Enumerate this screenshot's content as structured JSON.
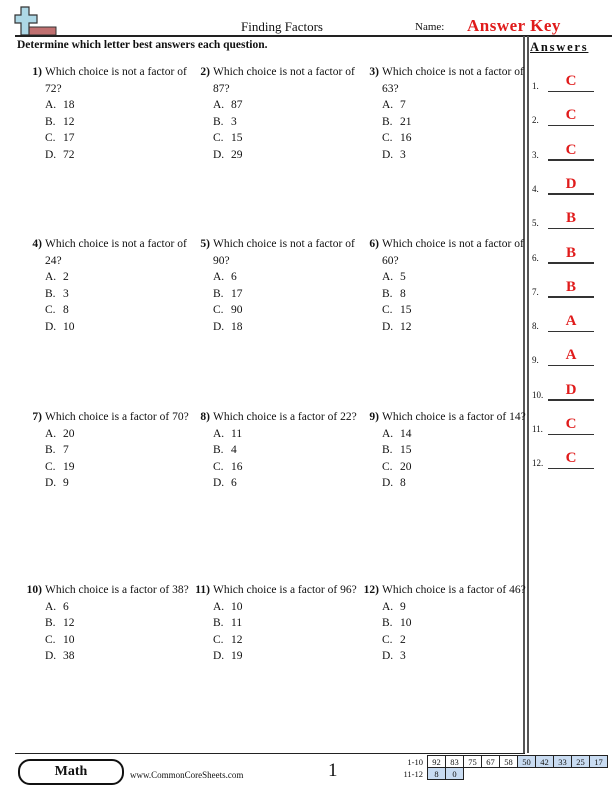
{
  "header": {
    "title": "Finding Factors",
    "name_label": "Name:",
    "name_value": "Answer Key",
    "instructions": "Determine which letter best answers each question."
  },
  "colors": {
    "answer_red": "#e01b1b",
    "logo_blue": "#add8e6",
    "logo_red": "#c07070",
    "score_highlight": "#c9dcf2"
  },
  "answers": {
    "heading": "Answers",
    "items": [
      {
        "num": "1.",
        "value": "C"
      },
      {
        "num": "2.",
        "value": "C"
      },
      {
        "num": "3.",
        "value": "C"
      },
      {
        "num": "4.",
        "value": "D"
      },
      {
        "num": "5.",
        "value": "B"
      },
      {
        "num": "6.",
        "value": "B"
      },
      {
        "num": "7.",
        "value": "B"
      },
      {
        "num": "8.",
        "value": "A"
      },
      {
        "num": "9.",
        "value": "A"
      },
      {
        "num": "10.",
        "value": "D"
      },
      {
        "num": "11.",
        "value": "C"
      },
      {
        "num": "12.",
        "value": "C"
      }
    ]
  },
  "questions": [
    {
      "num": "1)",
      "stem": "Which choice is not a factor of 72?",
      "choices": [
        {
          "letter": "A.",
          "text": "18"
        },
        {
          "letter": "B.",
          "text": "12"
        },
        {
          "letter": "C.",
          "text": "17"
        },
        {
          "letter": "D.",
          "text": "72"
        }
      ]
    },
    {
      "num": "2)",
      "stem": "Which choice is not a factor of 87?",
      "choices": [
        {
          "letter": "A.",
          "text": "87"
        },
        {
          "letter": "B.",
          "text": "3"
        },
        {
          "letter": "C.",
          "text": "15"
        },
        {
          "letter": "D.",
          "text": "29"
        }
      ]
    },
    {
      "num": "3)",
      "stem": "Which choice is not a factor of 63?",
      "choices": [
        {
          "letter": "A.",
          "text": "7"
        },
        {
          "letter": "B.",
          "text": "21"
        },
        {
          "letter": "C.",
          "text": "16"
        },
        {
          "letter": "D.",
          "text": "3"
        }
      ]
    },
    {
      "num": "4)",
      "stem": "Which choice is not a factor of 24?",
      "choices": [
        {
          "letter": "A.",
          "text": "2"
        },
        {
          "letter": "B.",
          "text": "3"
        },
        {
          "letter": "C.",
          "text": "8"
        },
        {
          "letter": "D.",
          "text": "10"
        }
      ]
    },
    {
      "num": "5)",
      "stem": "Which choice is not a factor of 90?",
      "choices": [
        {
          "letter": "A.",
          "text": "6"
        },
        {
          "letter": "B.",
          "text": "17"
        },
        {
          "letter": "C.",
          "text": "90"
        },
        {
          "letter": "D.",
          "text": "18"
        }
      ]
    },
    {
      "num": "6)",
      "stem": "Which choice is not a factor of 60?",
      "choices": [
        {
          "letter": "A.",
          "text": "5"
        },
        {
          "letter": "B.",
          "text": "8"
        },
        {
          "letter": "C.",
          "text": "15"
        },
        {
          "letter": "D.",
          "text": "12"
        }
      ]
    },
    {
      "num": "7)",
      "stem": "Which choice is a factor of 70?",
      "choices": [
        {
          "letter": "A.",
          "text": "20"
        },
        {
          "letter": "B.",
          "text": "7"
        },
        {
          "letter": "C.",
          "text": "19"
        },
        {
          "letter": "D.",
          "text": "9"
        }
      ]
    },
    {
      "num": "8)",
      "stem": "Which choice is a factor of 22?",
      "choices": [
        {
          "letter": "A.",
          "text": "11"
        },
        {
          "letter": "B.",
          "text": "4"
        },
        {
          "letter": "C.",
          "text": "16"
        },
        {
          "letter": "D.",
          "text": "6"
        }
      ]
    },
    {
      "num": "9)",
      "stem": "Which choice is a factor of 14?",
      "choices": [
        {
          "letter": "A.",
          "text": "14"
        },
        {
          "letter": "B.",
          "text": "15"
        },
        {
          "letter": "C.",
          "text": "20"
        },
        {
          "letter": "D.",
          "text": "8"
        }
      ]
    },
    {
      "num": "10)",
      "stem": "Which choice is a factor of 38?",
      "choices": [
        {
          "letter": "A.",
          "text": "6"
        },
        {
          "letter": "B.",
          "text": "12"
        },
        {
          "letter": "C.",
          "text": "10"
        },
        {
          "letter": "D.",
          "text": "38"
        }
      ]
    },
    {
      "num": "11)",
      "stem": "Which choice is a factor of 96?",
      "choices": [
        {
          "letter": "A.",
          "text": "10"
        },
        {
          "letter": "B.",
          "text": "11"
        },
        {
          "letter": "C.",
          "text": "12"
        },
        {
          "letter": "D.",
          "text": "19"
        }
      ]
    },
    {
      "num": "12)",
      "stem": "Which choice is a factor of 46?",
      "choices": [
        {
          "letter": "A.",
          "text": "9"
        },
        {
          "letter": "B.",
          "text": "10"
        },
        {
          "letter": "C.",
          "text": "2"
        },
        {
          "letter": "D.",
          "text": "3"
        }
      ]
    }
  ],
  "footer": {
    "subject": "Math",
    "site": "www.CommonCoreSheets.com",
    "page": "1",
    "score_rows": [
      {
        "label": "1-10",
        "cells": [
          "92",
          "83",
          "75",
          "67",
          "58",
          "50",
          "42",
          "33",
          "25",
          "17"
        ],
        "highlight_from": 5
      },
      {
        "label": "11-12",
        "cells": [
          "8",
          "0"
        ],
        "highlight_from": 0
      }
    ]
  }
}
